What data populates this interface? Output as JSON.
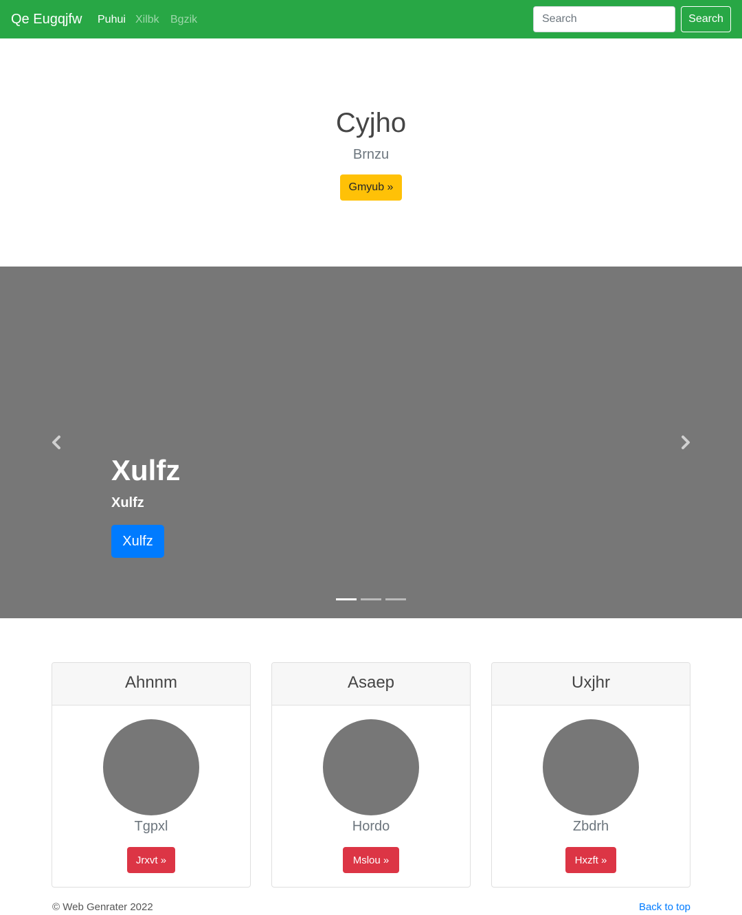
{
  "navbar": {
    "brand": "Qe Eugqjfw",
    "links": [
      {
        "label": "Puhui",
        "active": true
      },
      {
        "label": "Xilbk",
        "active": false
      },
      {
        "label": "Bgzik",
        "active": false
      }
    ],
    "search_placeholder": "Search",
    "search_button": "Search",
    "background_color": "#28a745"
  },
  "jumbotron": {
    "title": "Cyjho",
    "subtitle": "Brnzu",
    "button_label": "Gmyub »",
    "button_color": "#ffc107"
  },
  "carousel": {
    "slide": {
      "title": "Xulfz",
      "subtitle": "Xulfz",
      "button_label": "Xulfz",
      "button_color": "#007bff"
    },
    "prev_icon": "chevron-left-icon",
    "next_icon": "chevron-right-icon",
    "indicator_count": 3,
    "active_indicator": 0,
    "background_color": "#777777"
  },
  "cards": [
    {
      "title": "Ahnnm",
      "text": "Tgpxl",
      "button_label": "Jrxvt »"
    },
    {
      "title": "Asaep",
      "text": "Hordo",
      "button_label": "Mslou »"
    },
    {
      "title": "Uxjhr",
      "text": "Zbdrh",
      "button_label": "Hxzft »"
    }
  ],
  "card_button_color": "#dc3545",
  "footer": {
    "copyright": "© Web Genrater 2022",
    "back_to_top": "Back to top"
  }
}
